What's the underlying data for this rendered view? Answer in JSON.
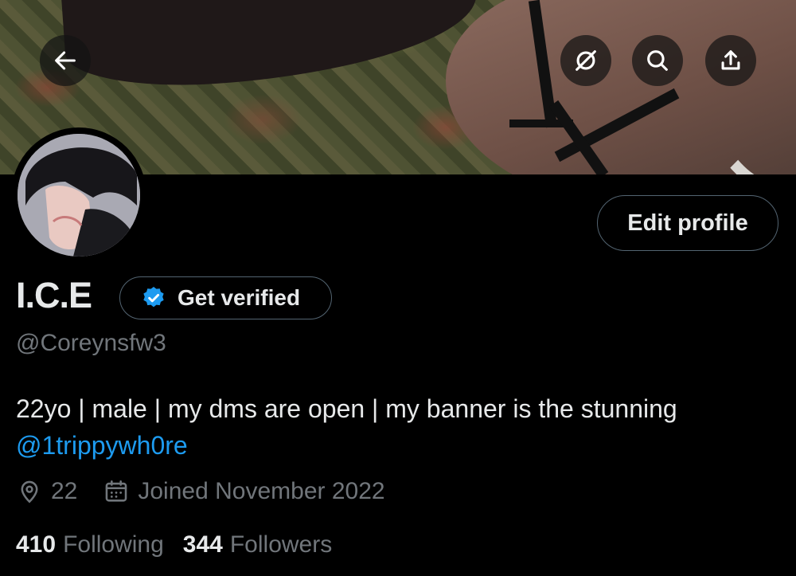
{
  "profile": {
    "display_name": "I.C.E",
    "handle": "@Coreynsfw3",
    "bio_text": "22yo | male | my dms are open | my banner is the stunning",
    "bio_mention": "@1trippywh0re",
    "location": "22",
    "joined": "Joined November 2022"
  },
  "buttons": {
    "edit_profile": "Edit profile",
    "get_verified": "Get verified"
  },
  "stats": {
    "following_count": "410",
    "following_label": "Following",
    "followers_count": "344",
    "followers_label": "Followers"
  },
  "header_icons": [
    "back-arrow-icon",
    "grok-icon",
    "search-icon",
    "share-icon"
  ],
  "colors": {
    "background": "#000000",
    "text_primary": "#e7e9ea",
    "text_secondary": "#71767b",
    "accent": "#1d9bf0",
    "border": "#536471"
  }
}
